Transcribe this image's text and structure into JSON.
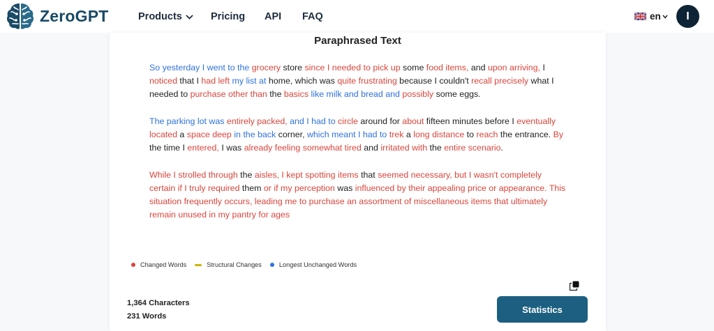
{
  "header": {
    "brand": "ZeroGPT",
    "nav": {
      "products": "Products",
      "pricing": "Pricing",
      "api": "API",
      "faq": "FAQ"
    },
    "language": "en",
    "avatar_initial": "I"
  },
  "result": {
    "title": "Paraphrased Text",
    "paragraphs": [
      [
        {
          "t": "So yesterday I went to the ",
          "k": "u"
        },
        {
          "t": "grocery",
          "k": "c"
        },
        {
          "t": " store ",
          "k": "n"
        },
        {
          "t": "since I needed to",
          "k": "c"
        },
        {
          "t": " ",
          "k": "n"
        },
        {
          "t": "pick up",
          "k": "c"
        },
        {
          "t": " some ",
          "k": "n"
        },
        {
          "t": "food items,",
          "k": "c"
        },
        {
          "t": " and ",
          "k": "n"
        },
        {
          "t": "upon arriving,",
          "k": "c"
        },
        {
          "t": " I ",
          "k": "n"
        },
        {
          "t": "noticed",
          "k": "c"
        },
        {
          "t": " that I ",
          "k": "n"
        },
        {
          "t": "had left",
          "k": "c"
        },
        {
          "t": " ",
          "k": "n"
        },
        {
          "t": "my list at",
          "k": "u"
        },
        {
          "t": " home, which was ",
          "k": "n"
        },
        {
          "t": "quite frustrating",
          "k": "c"
        },
        {
          "t": " because I couldn't ",
          "k": "n"
        },
        {
          "t": "recall precisely",
          "k": "c"
        },
        {
          "t": " what I needed to ",
          "k": "n"
        },
        {
          "t": "purchase other than",
          "k": "c"
        },
        {
          "t": " the ",
          "k": "n"
        },
        {
          "t": "basics",
          "k": "c"
        },
        {
          "t": " like milk and bread and ",
          "k": "u"
        },
        {
          "t": "possibly",
          "k": "c"
        },
        {
          "t": " some eggs.",
          "k": "n"
        }
      ],
      [
        {
          "t": "The parking lot was ",
          "k": "u"
        },
        {
          "t": "entirely packed,",
          "k": "c"
        },
        {
          "t": " and I had to ",
          "k": "u"
        },
        {
          "t": "circle",
          "k": "c"
        },
        {
          "t": " around for ",
          "k": "n"
        },
        {
          "t": "about",
          "k": "c"
        },
        {
          "t": " fifteen minutes before I ",
          "k": "n"
        },
        {
          "t": "eventually located",
          "k": "c"
        },
        {
          "t": " a ",
          "k": "n"
        },
        {
          "t": "space deep",
          "k": "c"
        },
        {
          "t": " in the back",
          "k": "u"
        },
        {
          "t": " corner, ",
          "k": "n"
        },
        {
          "t": "which meant I had to",
          "k": "u"
        },
        {
          "t": " ",
          "k": "n"
        },
        {
          "t": "trek",
          "k": "c"
        },
        {
          "t": " a ",
          "k": "n"
        },
        {
          "t": "long distance",
          "k": "c"
        },
        {
          "t": " to ",
          "k": "n"
        },
        {
          "t": "reach",
          "k": "c"
        },
        {
          "t": " the entrance. ",
          "k": "n"
        },
        {
          "t": "By",
          "k": "c"
        },
        {
          "t": " the time I ",
          "k": "n"
        },
        {
          "t": "entered,",
          "k": "c"
        },
        {
          "t": " I was ",
          "k": "n"
        },
        {
          "t": "already feeling somewhat tired",
          "k": "c"
        },
        {
          "t": " and ",
          "k": "n"
        },
        {
          "t": "irritated with",
          "k": "c"
        },
        {
          "t": " the ",
          "k": "n"
        },
        {
          "t": "entire scenario",
          "k": "c"
        },
        {
          "t": ".",
          "k": "n"
        }
      ],
      [
        {
          "t": "While I strolled through",
          "k": "c"
        },
        {
          "t": " the ",
          "k": "n"
        },
        {
          "t": "aisles, I kept spotting items",
          "k": "c"
        },
        {
          "t": " that ",
          "k": "n"
        },
        {
          "t": "seemed necessary, but I wasn't completely certain if I truly required",
          "k": "c"
        },
        {
          "t": " them ",
          "k": "n"
        },
        {
          "t": "or if my perception",
          "k": "c"
        },
        {
          "t": " was ",
          "k": "n"
        },
        {
          "t": "influenced by their appealing price or appearance.",
          "k": "c"
        },
        {
          "t": " ",
          "k": "n"
        },
        {
          "t": "This situation frequently occurs, leading me to purchase an assortment of miscellaneous items that ultimately remain unused in my pantry for ages",
          "k": "c"
        }
      ]
    ],
    "legend": {
      "changed": "Changed Words",
      "structural": "Structural Changes",
      "unchanged": "Longest Unchanged Words"
    },
    "colors": {
      "changed": "#d9453b",
      "structural": "#c9b400",
      "unchanged": "#2f72de",
      "button": "#1c5f80",
      "brand": "#1a4a66"
    },
    "characters": "1,364 Characters",
    "words": "231 Words",
    "statistics_button": "Statistics",
    "icons": {
      "copy": "copy-icon",
      "logo": "brain-logo-icon",
      "language": "uk-flag-icon"
    }
  }
}
